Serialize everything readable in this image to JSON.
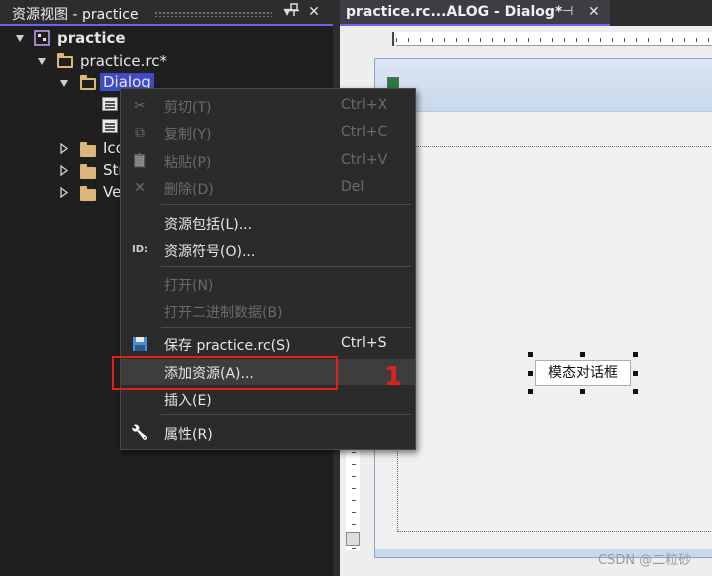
{
  "resource_view": {
    "title": "资源视图 - practice",
    "pin_glyph": "⊥",
    "close_glyph": "✕",
    "tree": {
      "root": "practice",
      "rc_file": "practice.rc*",
      "dialog_folder": "Dialog",
      "icon_folder": "Ico",
      "string_folder": "Str",
      "version_folder": "Ve"
    }
  },
  "editor": {
    "tab_title": "practice.rc...ALOG - Dialog*",
    "tab_pin_glyph": "⊣",
    "tab_close_glyph": "✕",
    "button_label": "模态对话框"
  },
  "context_menu": {
    "items": [
      {
        "label": "剪切(T)",
        "shortcut": "Ctrl+X",
        "icon": "scissors-icon",
        "glyph": "✂",
        "enabled": false
      },
      {
        "label": "复制(Y)",
        "shortcut": "Ctrl+C",
        "icon": "copy-icon",
        "glyph": "⧉",
        "enabled": false
      },
      {
        "label": "粘贴(P)",
        "shortcut": "Ctrl+V",
        "icon": "paste-icon",
        "glyph": "📋",
        "enabled": false
      },
      {
        "label": "删除(D)",
        "shortcut": "Del",
        "icon": "delete-icon",
        "glyph": "✕",
        "enabled": false
      },
      {
        "label": "资源包括(L)...",
        "shortcut": "",
        "icon": "",
        "glyph": "",
        "enabled": true
      },
      {
        "label": "资源符号(O)...",
        "shortcut": "",
        "icon": "id-icon",
        "glyph": "ID:",
        "enabled": true
      },
      {
        "label": "打开(N)",
        "shortcut": "",
        "icon": "",
        "glyph": "",
        "enabled": false
      },
      {
        "label": "打开二进制数据(B)",
        "shortcut": "",
        "icon": "",
        "glyph": "",
        "enabled": false
      },
      {
        "label": "保存 practice.rc(S)",
        "shortcut": "Ctrl+S",
        "icon": "save-icon",
        "glyph": "💾",
        "enabled": true
      },
      {
        "label": "添加资源(A)...",
        "shortcut": "",
        "icon": "",
        "glyph": "",
        "enabled": true
      },
      {
        "label": "插入(E)",
        "shortcut": "",
        "icon": "",
        "glyph": "",
        "enabled": true
      },
      {
        "label": "属性(R)",
        "shortcut": "",
        "icon": "wrench-icon",
        "glyph": "🔧",
        "enabled": true
      }
    ]
  },
  "annotation": {
    "step": "1",
    "color": "#e02020"
  },
  "watermark": "CSDN @二粒砂",
  "colors": {
    "accent": "#6f63e6",
    "selection": "#3f4bc9",
    "folder": "#dcb67a"
  }
}
